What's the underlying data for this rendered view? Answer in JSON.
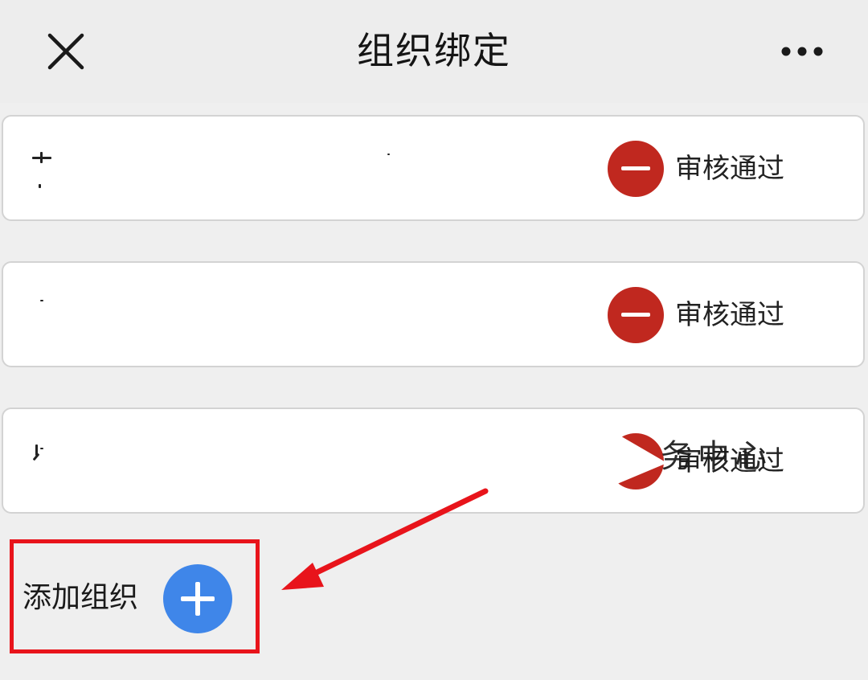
{
  "header": {
    "title": "组织绑定",
    "close_icon": "close-icon",
    "more_icon": "more-horizontal-icon"
  },
  "organizations": [
    {
      "name": "",
      "status": "审核通过",
      "remove_icon": "minus-circle-icon"
    },
    {
      "name": "",
      "status": "审核通过",
      "remove_icon": "minus-circle-icon"
    },
    {
      "name": "",
      "status": "审核通过",
      "remove_icon": "minus-circle-icon"
    }
  ],
  "overlay_text": "务中心",
  "add_org": {
    "label": "添加组织",
    "icon": "plus-circle-icon"
  },
  "annotation": {
    "highlight_color": "#e8141b",
    "arrow_color": "#e8141b"
  },
  "colors": {
    "remove_red": "#c0281f",
    "add_blue": "#3f86e9",
    "background": "#efefef"
  }
}
